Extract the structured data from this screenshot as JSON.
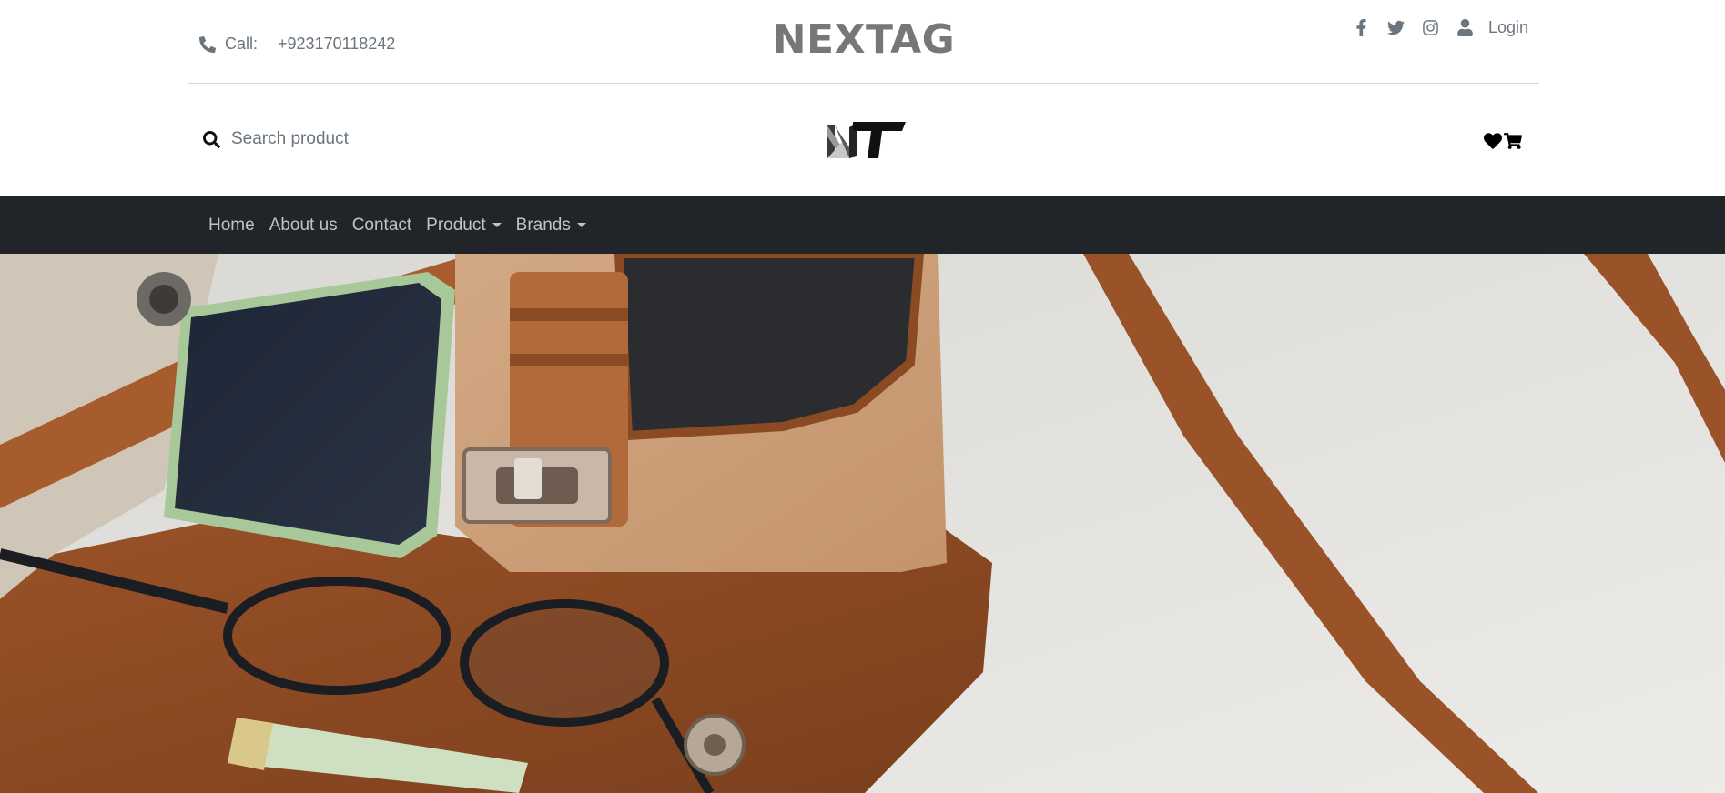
{
  "header": {
    "call_label": "Call:",
    "phone": "+923170118242",
    "brand": "NEXTAG",
    "login": "Login",
    "social_icons": [
      "facebook-icon",
      "twitter-icon",
      "instagram-icon",
      "user-icon"
    ]
  },
  "search": {
    "placeholder": "Search product"
  },
  "logo": {
    "alt": "NT"
  },
  "shop_icons": [
    "heart-icon",
    "cart-icon"
  ],
  "nav": {
    "items": [
      {
        "label": "Home",
        "dropdown": false
      },
      {
        "label": "About us",
        "dropdown": false
      },
      {
        "label": "Contact",
        "dropdown": false
      },
      {
        "label": "Product",
        "dropdown": true
      },
      {
        "label": "Brands",
        "dropdown": true
      }
    ]
  },
  "hero": {
    "image": "leather-bag-hero-image"
  },
  "colors": {
    "nav_bg": "#212529",
    "nav_text": "rgba(255,255,255,0.72)",
    "muted_text": "#6c757d",
    "brand_text": "#777777"
  }
}
